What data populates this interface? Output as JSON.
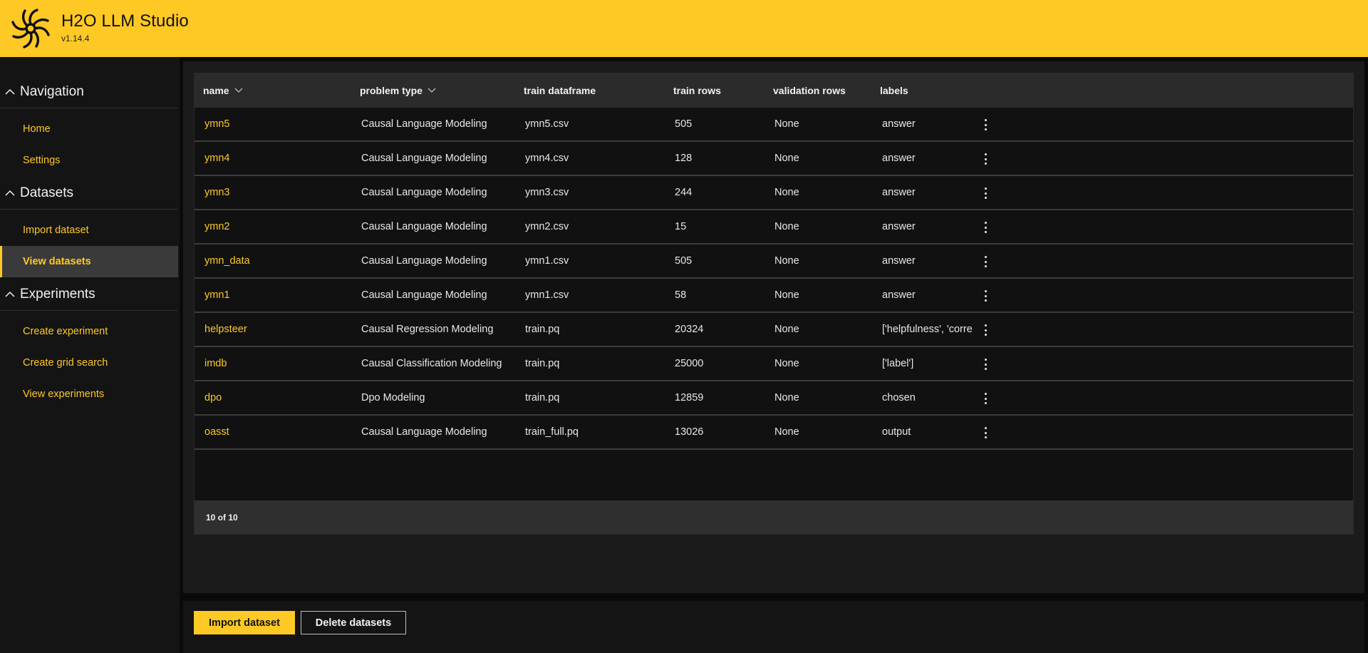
{
  "app": {
    "title": "H2O LLM Studio",
    "version": "v1.14.4",
    "accent_color": "#fec925"
  },
  "sidebar": {
    "sections": [
      {
        "label": "Navigation",
        "icon": "chevron-up-icon",
        "items": [
          {
            "label": "Home",
            "active": false
          },
          {
            "label": "Settings",
            "active": false
          }
        ]
      },
      {
        "label": "Datasets",
        "icon": "chevron-up-icon",
        "items": [
          {
            "label": "Import dataset",
            "active": false
          },
          {
            "label": "View datasets",
            "active": true
          }
        ]
      },
      {
        "label": "Experiments",
        "icon": "chevron-up-icon",
        "items": [
          {
            "label": "Create experiment",
            "active": false
          },
          {
            "label": "Create grid search",
            "active": false
          },
          {
            "label": "View experiments",
            "active": false
          }
        ]
      }
    ]
  },
  "table": {
    "columns": [
      {
        "label": "name",
        "sortable": true
      },
      {
        "label": "problem type",
        "sortable": true
      },
      {
        "label": "train dataframe",
        "sortable": false
      },
      {
        "label": "train rows",
        "sortable": false
      },
      {
        "label": "validation rows",
        "sortable": false
      },
      {
        "label": "labels",
        "sortable": false
      }
    ],
    "rows": [
      [
        "ymn5",
        "Causal Language Modeling",
        "ymn5.csv",
        "505",
        "None",
        "answer"
      ],
      [
        "ymn4",
        "Causal Language Modeling",
        "ymn4.csv",
        "128",
        "None",
        "answer"
      ],
      [
        "ymn3",
        "Causal Language Modeling",
        "ymn3.csv",
        "244",
        "None",
        "answer"
      ],
      [
        "ymn2",
        "Causal Language Modeling",
        "ymn2.csv",
        "15",
        "None",
        "answer"
      ],
      [
        "ymn_data",
        "Causal Language Modeling",
        "ymn1.csv",
        "505",
        "None",
        "answer"
      ],
      [
        "ymn1",
        "Causal Language Modeling",
        "ymn1.csv",
        "58",
        "None",
        "answer"
      ],
      [
        "helpsteer",
        "Causal Regression Modeling",
        "train.pq",
        "20324",
        "None",
        "['helpfulness', 'corre"
      ],
      [
        "imdb",
        "Causal Classification Modeling",
        "train.pq",
        "25000",
        "None",
        "['label']"
      ],
      [
        "dpo",
        "Dpo Modeling",
        "train.pq",
        "12859",
        "None",
        "chosen"
      ],
      [
        "oasst",
        "Causal Language Modeling",
        "train_full.pq",
        "13026",
        "None",
        "output"
      ]
    ],
    "row_menu_icon": "more-vertical-icon",
    "footer_count": "10 of 10"
  },
  "actions": {
    "import_label": "Import dataset",
    "delete_label": "Delete datasets"
  }
}
